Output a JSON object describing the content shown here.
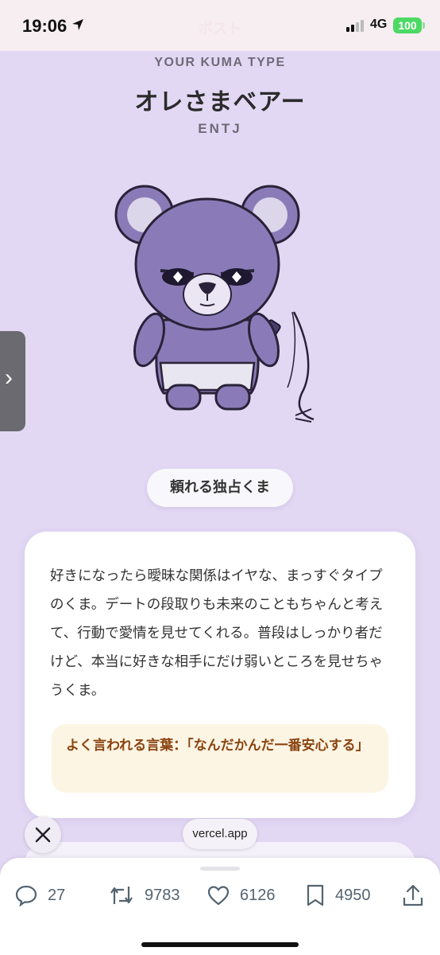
{
  "status_bar": {
    "time": "19:06",
    "title": "ポスト",
    "network": "4G",
    "battery": "100"
  },
  "result": {
    "label": "YOUR KUMA TYPE",
    "name": "オレさまベアー",
    "code": "ENTJ",
    "tag": "頼れる独占くま",
    "description": "好きになったら曖昧な関係はイヤな、まっすぐタイプのくま。デートの段取りも未来のこともちゃんと考えて、行動で愛情を見せてくれる。普段はしっかり者だけど、本当に好きな相手にだけ弱いところを見せちゃうくま。",
    "quote": "よく言われる言葉：「なんだかんだ一番安心する」"
  },
  "side_tab": {
    "icon": "chevron-right-icon"
  },
  "overlay": {
    "url": "vercel.app",
    "close_icon": "close-icon"
  },
  "actions": {
    "replies": "27",
    "reposts": "9783",
    "likes": "6126",
    "bookmarks": "4950"
  },
  "colors": {
    "background": "#e2d8f4",
    "bear": "#8a7bb8",
    "quote_bg": "#fdf5e4",
    "quote_text": "#8a4410",
    "battery": "#4cd964"
  }
}
